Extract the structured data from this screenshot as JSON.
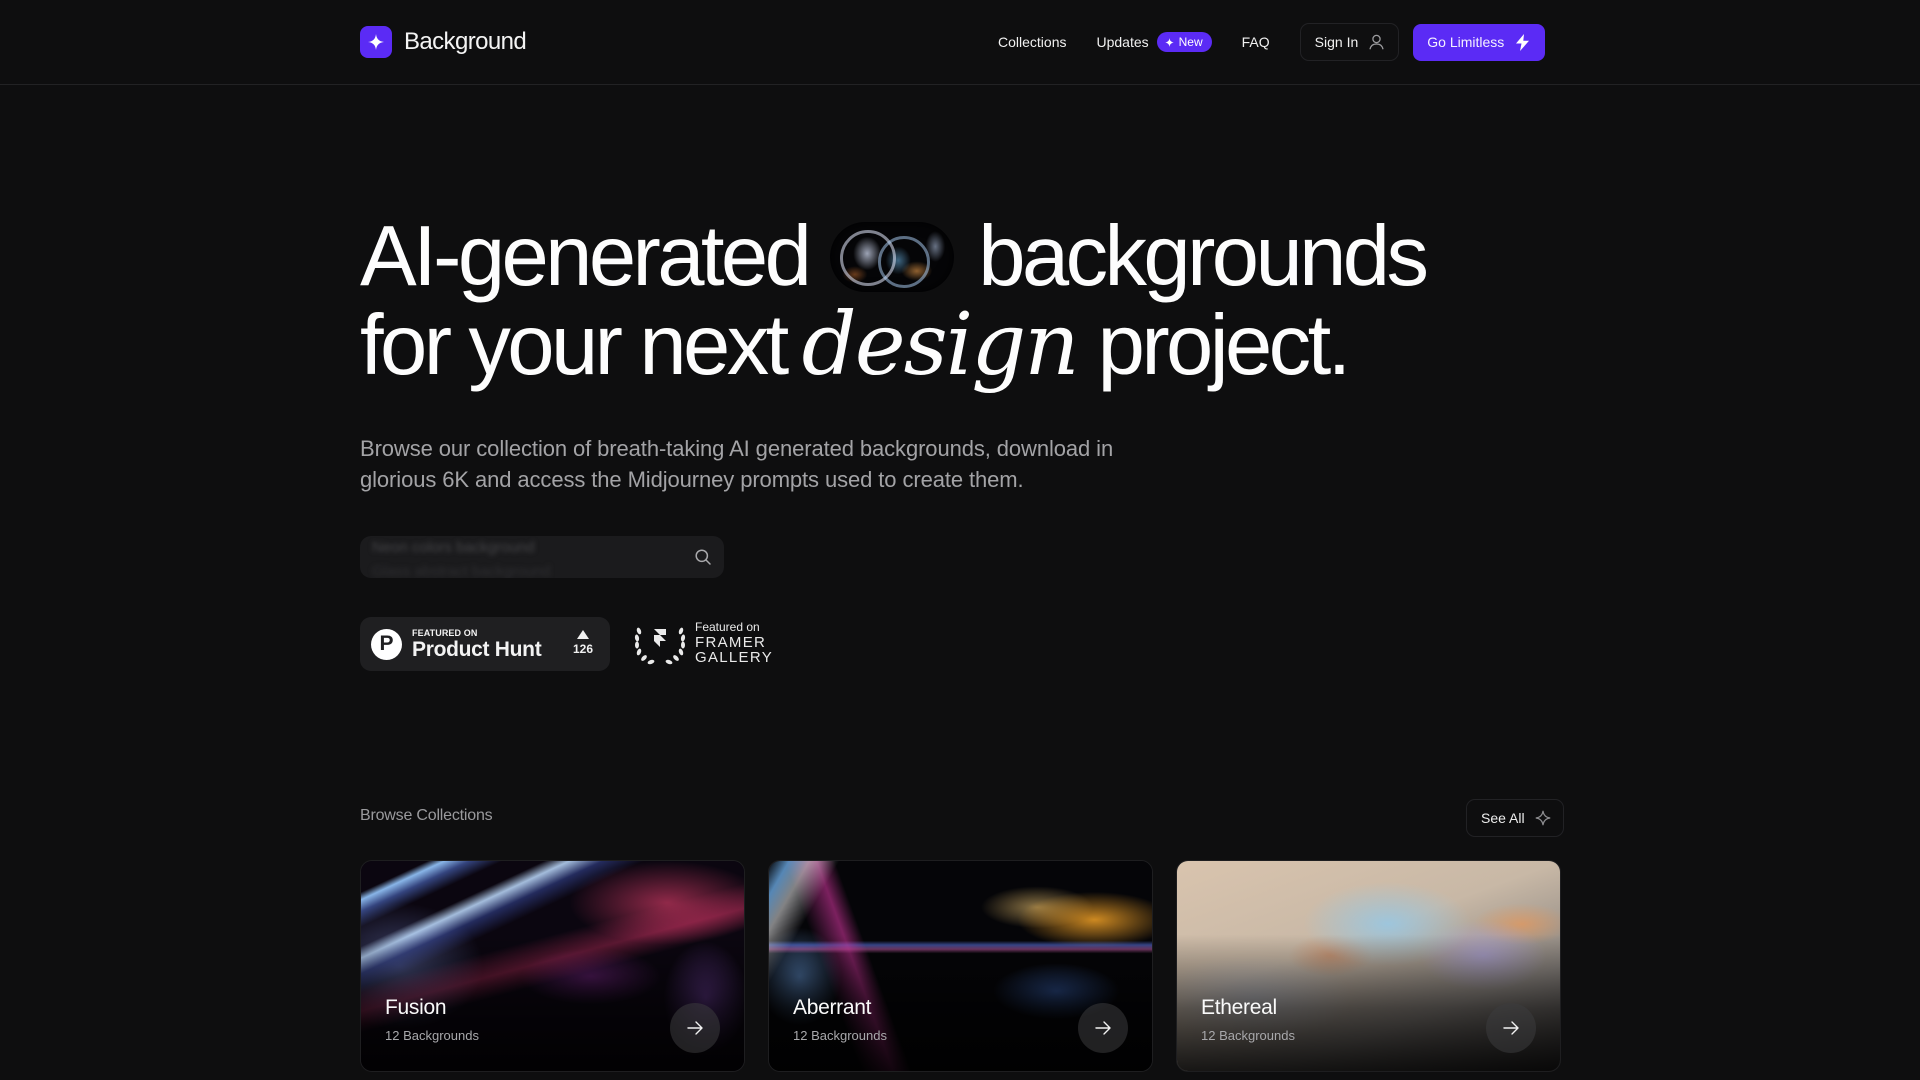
{
  "nav": {
    "brand": "Background",
    "brand_icon": "sparkle-icon",
    "links": {
      "collections": "Collections",
      "updates": "Updates",
      "updates_badge": "New",
      "faq": "FAQ"
    },
    "sign_in": "Sign In",
    "sign_in_icon": "user-icon",
    "cta": "Go Limitless",
    "cta_icon": "lightning-icon"
  },
  "hero": {
    "line1_before": "AI-generated",
    "line1_after": "backgrounds",
    "line2_before": "for your next",
    "line2_italic": "design",
    "line2_after": "project.",
    "subtitle": "Browse our collection of breath-taking AI generated backgrounds, download in glorious 6K and access the Midjourney prompts used to create them."
  },
  "search": {
    "placeholder_line1": "Neon colors background",
    "placeholder_line2": "Glass abstract background",
    "icon": "search-icon"
  },
  "badges": {
    "product_hunt": {
      "small": "FEATURED ON",
      "big": "Product Hunt",
      "votes": "126"
    },
    "framer": {
      "small": "Featured on",
      "line1": "FRAMER",
      "line2": "GALLERY"
    }
  },
  "collections": {
    "label": "Browse Collections",
    "see_all": "See All",
    "items": [
      {
        "title": "Fusion",
        "count": "12 Backgrounds"
      },
      {
        "title": "Aberrant",
        "count": "12 Backgrounds"
      },
      {
        "title": "Ethereal",
        "count": "12 Backgrounds"
      }
    ]
  },
  "colors": {
    "background": "#0e0e0f",
    "accent": "#5b2bf5",
    "muted_text": "#a3a3a6"
  }
}
